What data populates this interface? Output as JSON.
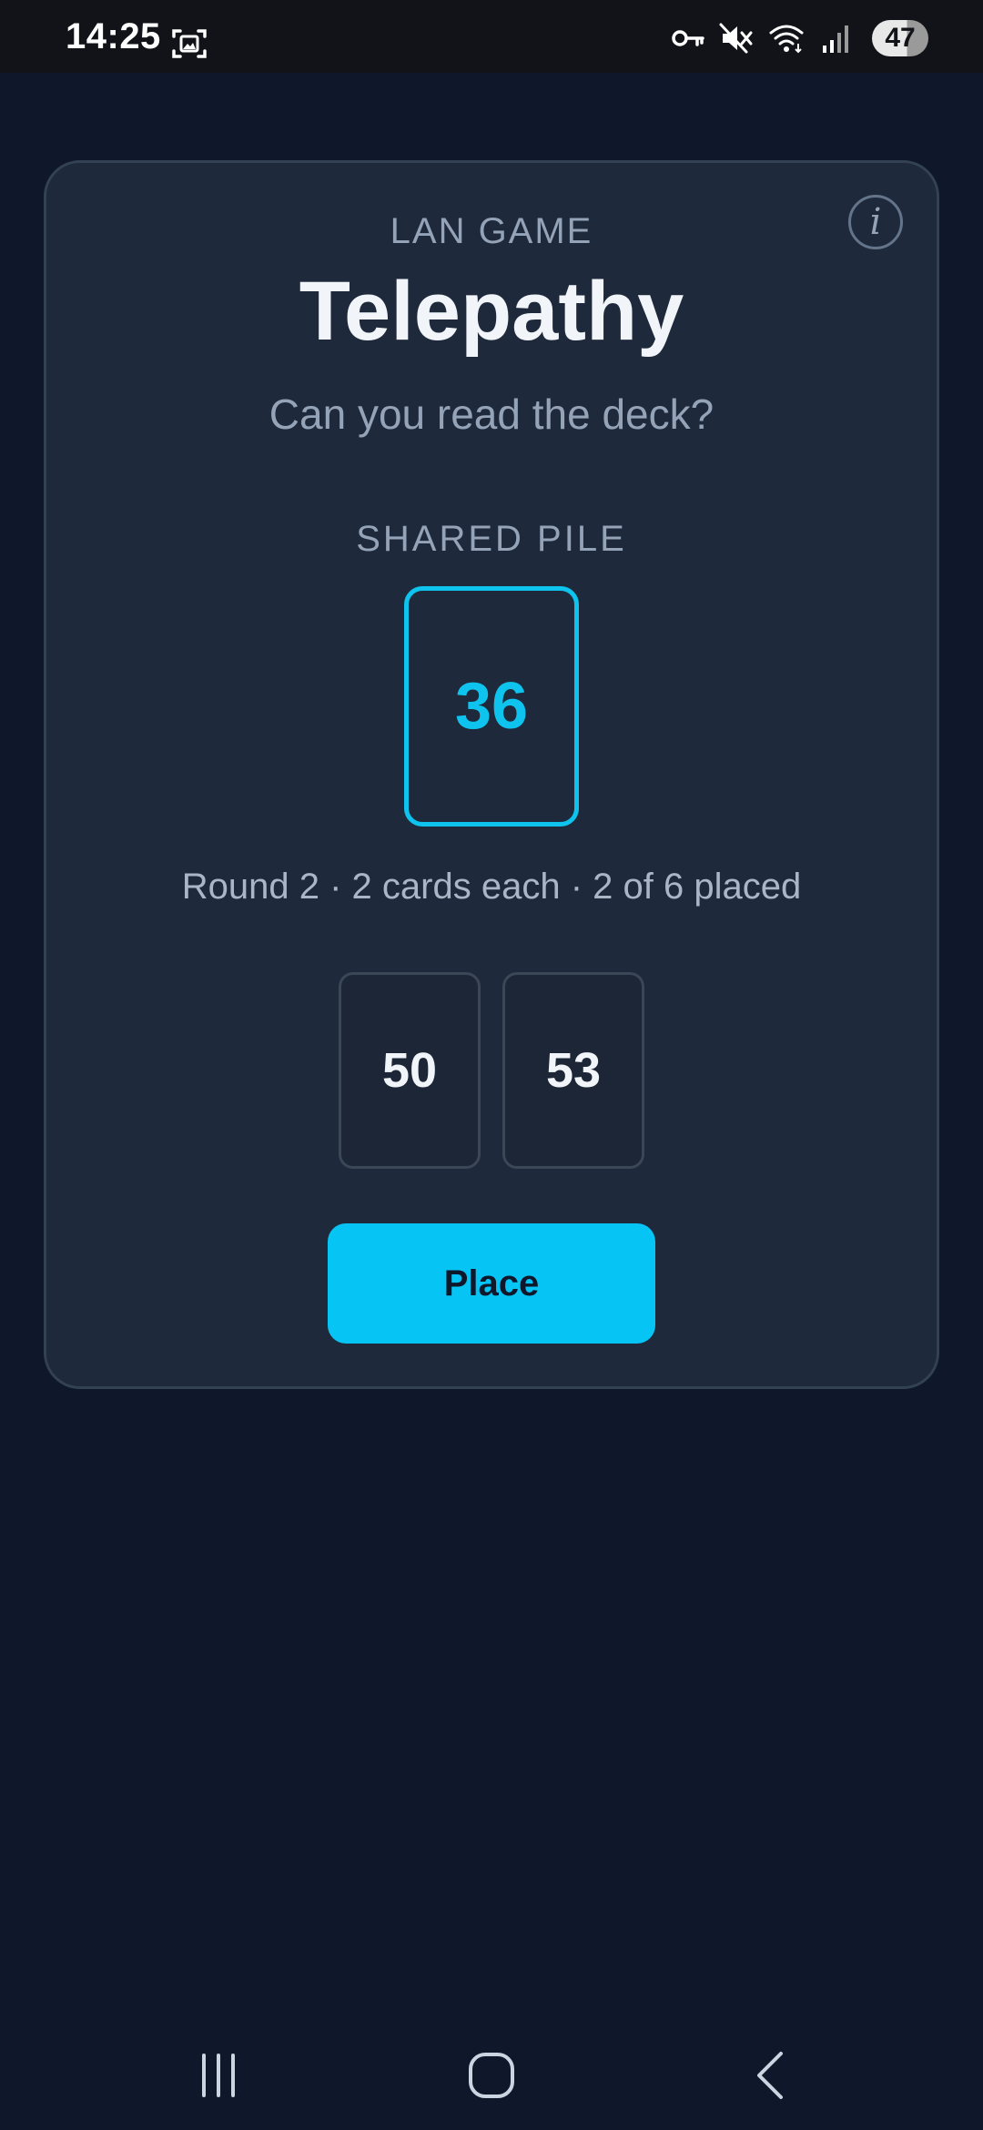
{
  "status_bar": {
    "time": "14:25",
    "battery_level": "47",
    "icons": [
      "screenshot-icon",
      "key-icon",
      "mute-icon",
      "wifi-icon",
      "signal-icon"
    ]
  },
  "game": {
    "eyebrow": "LAN GAME",
    "title": "Telepathy",
    "subtitle": "Can you read the deck?",
    "info_icon": "i",
    "pile_label": "SHARED PILE",
    "pile_card": "36",
    "round_status": "Round 2 · 2 cards each · 2 of 6 placed",
    "hand": [
      "50",
      "53"
    ],
    "place_label": "Place"
  },
  "colors": {
    "background": "#0f172a",
    "panel": "#1e293b",
    "accent": "#06c4f4",
    "muted_text": "#94a3b8"
  },
  "nav_bar": {
    "buttons": [
      "recents-icon",
      "home-icon",
      "back-icon"
    ]
  }
}
